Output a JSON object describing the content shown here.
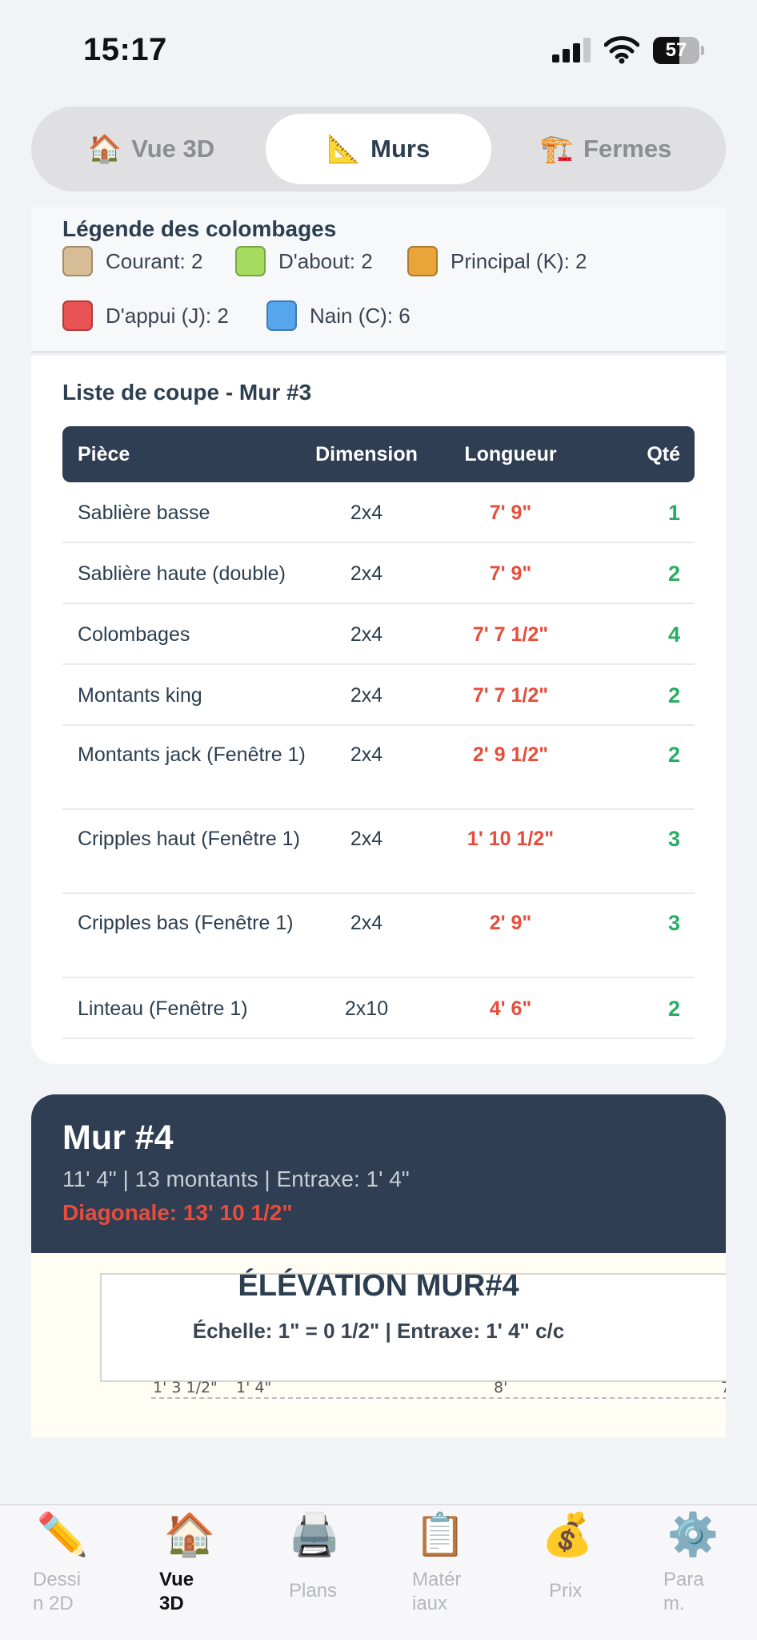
{
  "status": {
    "time": "15:17",
    "battery": "57"
  },
  "segments": [
    {
      "icon": "🏠",
      "label": "Vue 3D",
      "active": false
    },
    {
      "icon": "📐",
      "label": "Murs",
      "active": true
    },
    {
      "icon": "🏗️",
      "label": "Fermes",
      "active": false
    }
  ],
  "legend": {
    "title": "Légende des colombages",
    "items": [
      {
        "label": "Courant: 2",
        "color": "#d7bd96"
      },
      {
        "label": "D'about: 2",
        "color": "#a5db5f"
      },
      {
        "label": "Principal (K): 2",
        "color": "#eaa53a"
      },
      {
        "label": "D'appui (J): 2",
        "color": "#e95353"
      },
      {
        "label": "Nain (C): 6",
        "color": "#56a6ec"
      }
    ]
  },
  "cutlist": {
    "title": "Liste de coupe - Mur #3",
    "headers": {
      "piece": "Pièce",
      "dimension": "Dimension",
      "longueur": "Longueur",
      "qte": "Qté"
    },
    "rows": [
      {
        "piece": "Sablière basse",
        "dimension": "2x4",
        "longueur": "7' 9\"",
        "qte": "1"
      },
      {
        "piece": "Sablière haute (double)",
        "dimension": "2x4",
        "longueur": "7' 9\"",
        "qte": "2"
      },
      {
        "piece": "Colombages",
        "dimension": "2x4",
        "longueur": "7' 7 1/2\"",
        "qte": "4"
      },
      {
        "piece": "Montants king",
        "dimension": "2x4",
        "longueur": "7' 7 1/2\"",
        "qte": "2"
      },
      {
        "piece": "Montants jack (Fenêtre 1)",
        "dimension": "2x4",
        "longueur": "2' 9 1/2\"",
        "qte": "2"
      },
      {
        "piece": "Cripples haut (Fenêtre 1)",
        "dimension": "2x4",
        "longueur": "1' 10 1/2\"",
        "qte": "3"
      },
      {
        "piece": "Cripples bas (Fenêtre 1)",
        "dimension": "2x4",
        "longueur": "2' 9\"",
        "qte": "3"
      },
      {
        "piece": "Linteau (Fenêtre 1)",
        "dimension": "2x10",
        "longueur": "4' 6\"",
        "qte": "2"
      }
    ]
  },
  "wall": {
    "title": "Mur #4",
    "meta": "11' 4\" | 13 montants | Entraxe: 1' 4\"",
    "diagonal": "Diagonale: 13' 10 1/2\""
  },
  "elevation": {
    "title": "ÉLÉVATION MUR#4",
    "subtitle": "Échelle: 1\" = 0 1/2\" | Entraxe: 1' 4\" c/c",
    "dim_labels": [
      "1' 3 1/2\"",
      "1' 4\"",
      "8'",
      "7"
    ]
  },
  "nav": [
    {
      "icon": "✏️",
      "label": "Dessi\nn 2D",
      "active": false
    },
    {
      "icon": "🏠",
      "label": "Vue\n3D",
      "active": true
    },
    {
      "icon": "🖨️",
      "label": "Plans",
      "active": false
    },
    {
      "icon": "📋",
      "label": "Matér\niaux",
      "active": false
    },
    {
      "icon": "💰",
      "label": "Prix",
      "active": false
    },
    {
      "icon": "⚙️",
      "label": "Para\nm.",
      "active": false
    }
  ]
}
